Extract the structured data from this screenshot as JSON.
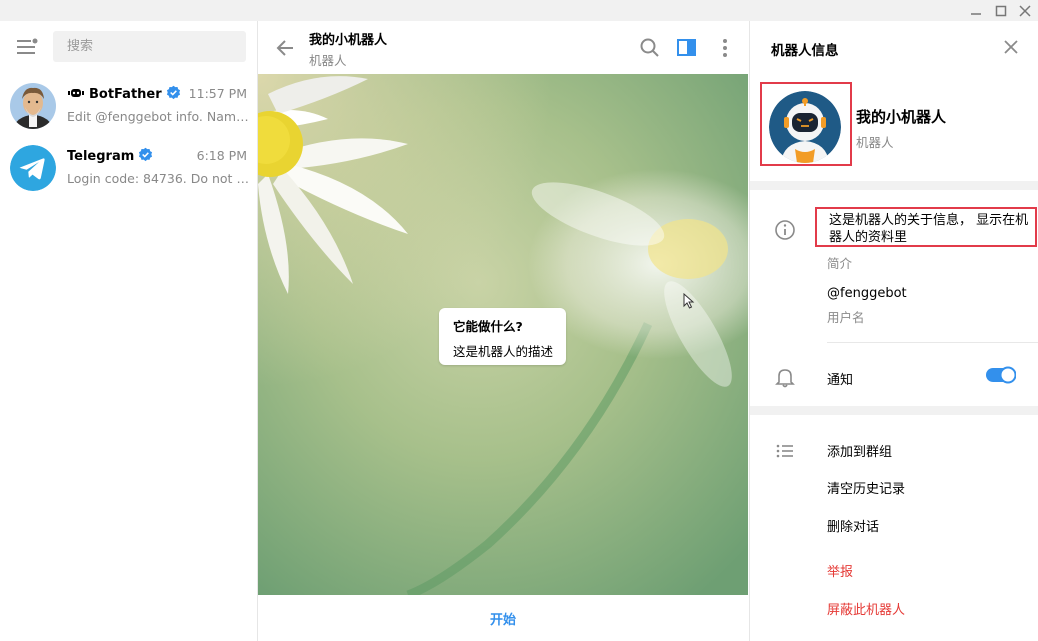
{
  "window": {
    "controls": [
      "minimize",
      "maximize",
      "close"
    ]
  },
  "sidebar": {
    "search_placeholder": "搜索",
    "chats": [
      {
        "name": "BotFather",
        "verified": true,
        "time": "11:57 PM",
        "preview": "Edit @fenggebot info. Name..."
      },
      {
        "name": "Telegram",
        "verified": true,
        "time": "6:18 PM",
        "preview": "Login code: 84736. Do not gi..."
      }
    ]
  },
  "chat": {
    "title": "我的小机器人",
    "subtitle": "机器人",
    "intro_title": "它能做什么?",
    "intro_desc": "这是机器人的描述",
    "start_label": "开始"
  },
  "info_panel": {
    "title": "机器人信息",
    "profile_name": "我的小机器人",
    "profile_sub": "机器人",
    "about_text": "这是机器人的关于信息， 显示在机器人的资料里",
    "about_label": "简介",
    "username": "@fenggebot",
    "username_label": "用户名",
    "notify_label": "通知",
    "notify_on": true,
    "actions": {
      "add_to_group": "添加到群组",
      "clear_history": "清空历史记录",
      "delete_chat": "删除对话",
      "report": "举报",
      "block": "屏蔽此机器人"
    }
  },
  "colors": {
    "accent": "#3390ec",
    "verified": "#3390ec",
    "danger": "#e53935",
    "highlight_border": "#e23b4a",
    "panel_separator": "#f1f1f1"
  }
}
